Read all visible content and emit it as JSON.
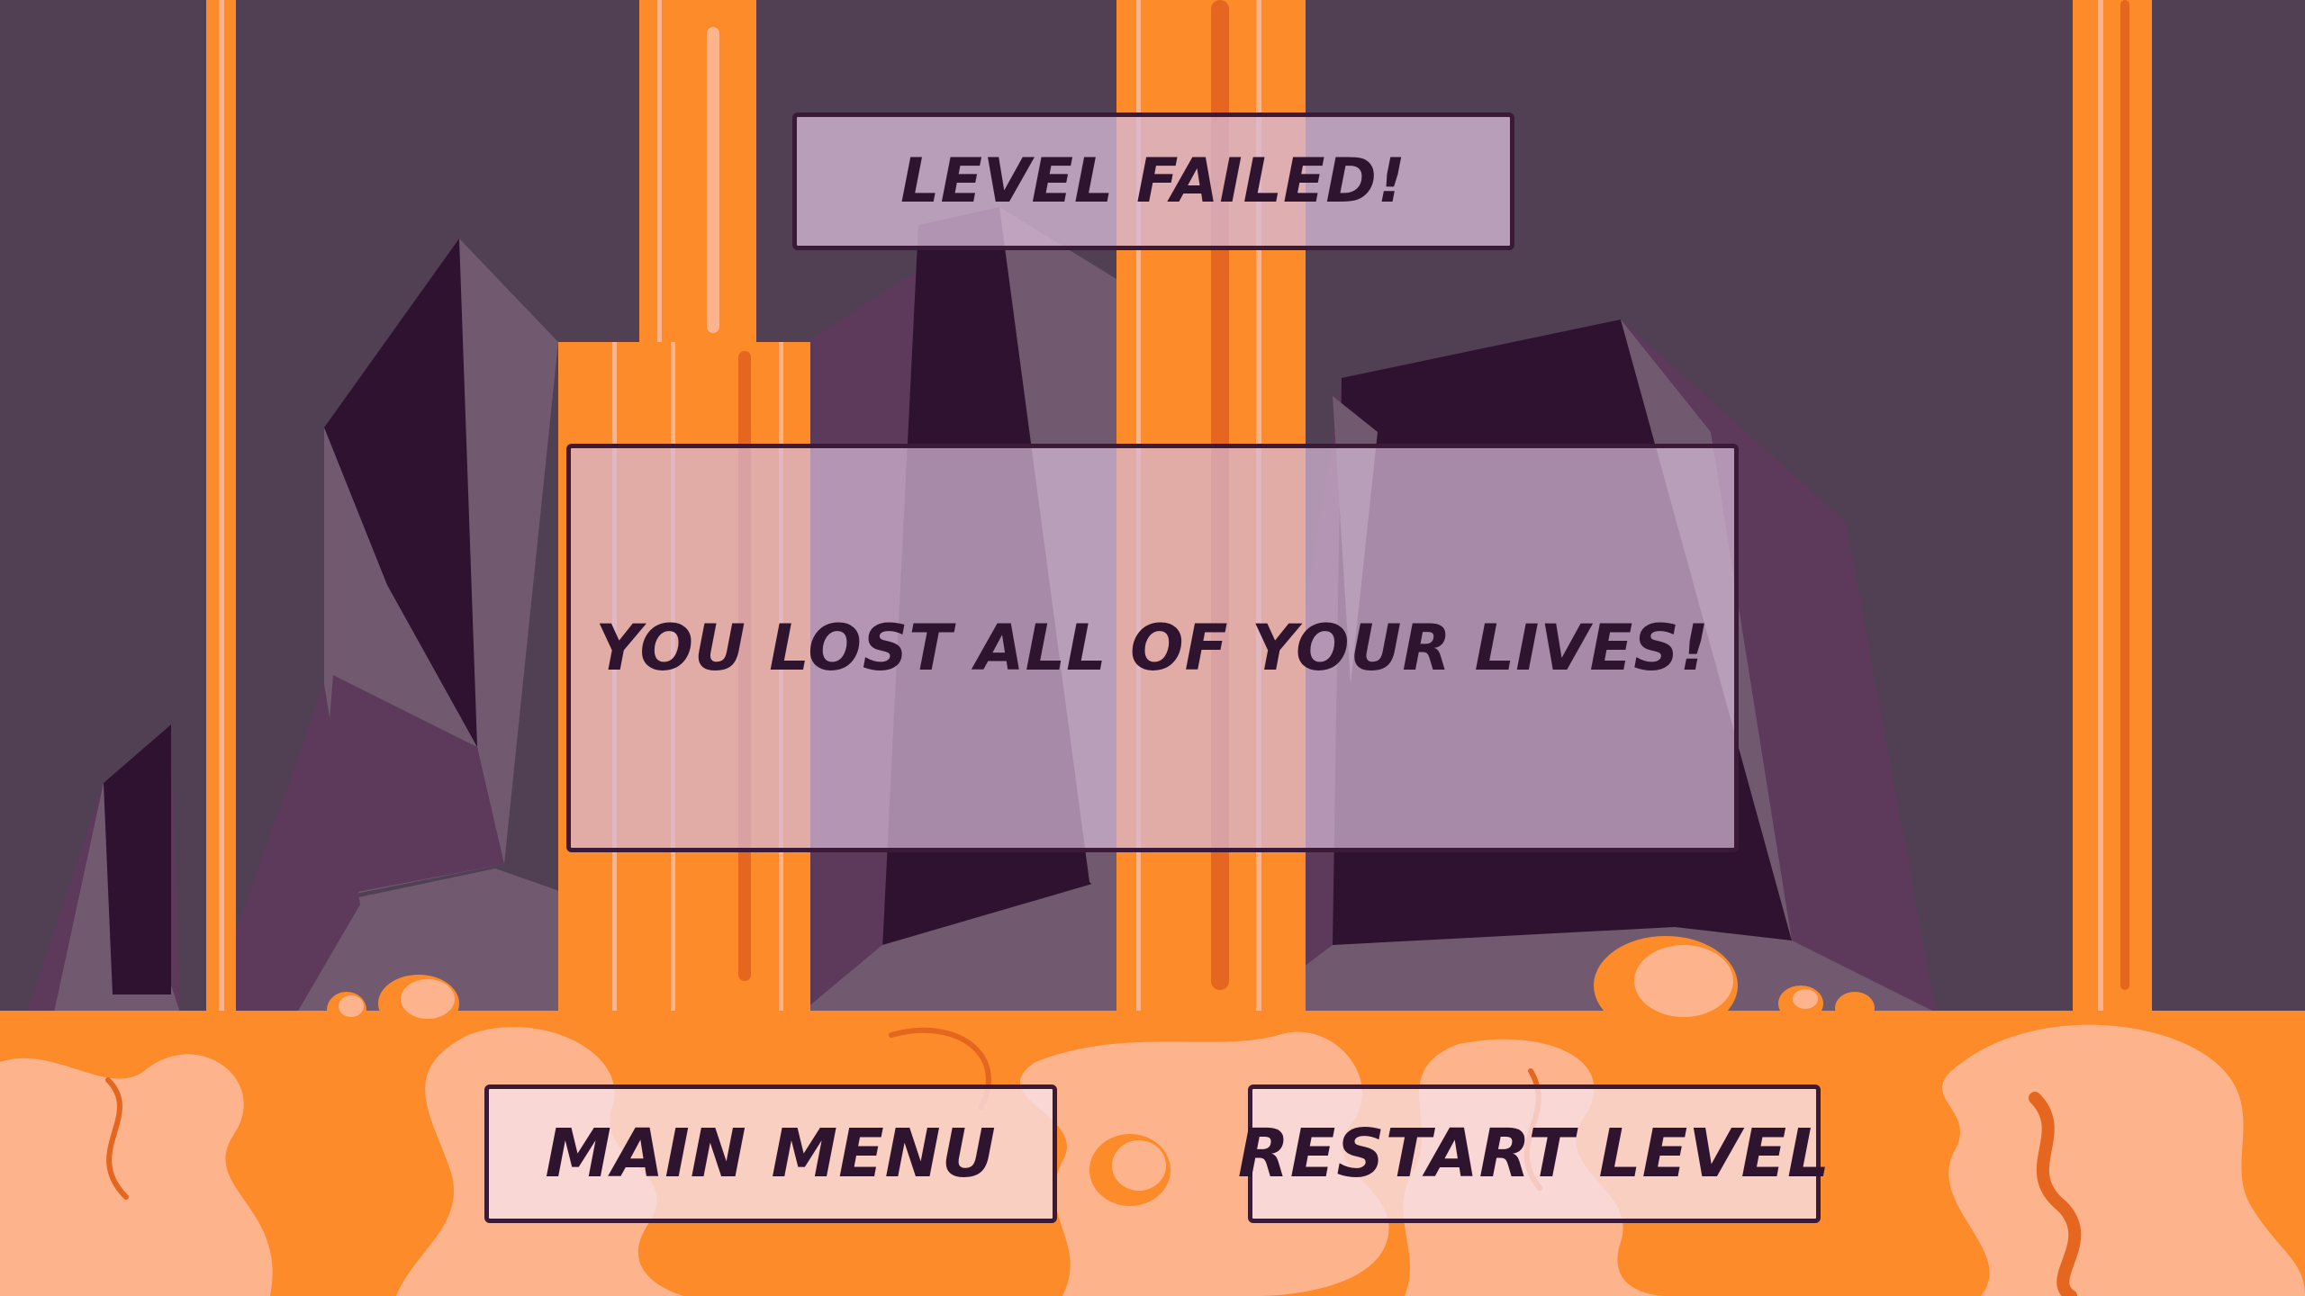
{
  "dialog": {
    "title": "LEVEL FAILED!",
    "message": "YOU LOST ALL OF YOUR LIVES!"
  },
  "buttons": {
    "main_menu": "MAIN MENU",
    "restart_level": "RESTART LEVEL"
  },
  "colors": {
    "sky": "#513f54",
    "rock_dark": "#2e1230",
    "rock_mid": "#5d3a5b",
    "rock_light": "#715a70",
    "lava": "#fd8b2a",
    "lava_light": "#fdb48d",
    "lava_dark": "#e5661f",
    "panel_border": "#3b1a37",
    "text": "#2f1430"
  }
}
